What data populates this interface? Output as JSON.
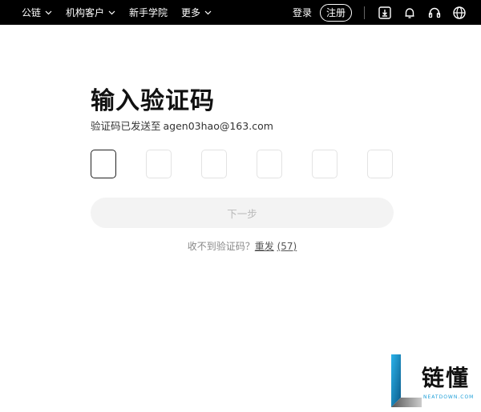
{
  "nav": {
    "items": [
      {
        "label": "公链",
        "dropdown": true
      },
      {
        "label": "机构客户",
        "dropdown": true
      },
      {
        "label": "新手学院",
        "dropdown": false
      },
      {
        "label": "更多",
        "dropdown": true
      }
    ],
    "login_label": "登录",
    "register_label": "注册",
    "icons": [
      "download-icon",
      "bell-icon",
      "headset-icon",
      "globe-icon"
    ]
  },
  "verify": {
    "title": "输入验证码",
    "subtitle_prefix": "验证码已发送至",
    "email": "agen03hao@163.com",
    "code_length": 6,
    "next_label": "下一步",
    "resend_prompt": "收不到验证码？",
    "resend_label": "重发",
    "countdown": "(57)"
  },
  "watermark": {
    "brand": "链懂",
    "sub": "NEATDOWN.COM"
  },
  "colors": {
    "topbar_bg": "#000000",
    "button_disabled_bg": "#f3f3f3",
    "button_disabled_text": "#b8b8b8",
    "watermark_accent": "#1e9fd8"
  }
}
